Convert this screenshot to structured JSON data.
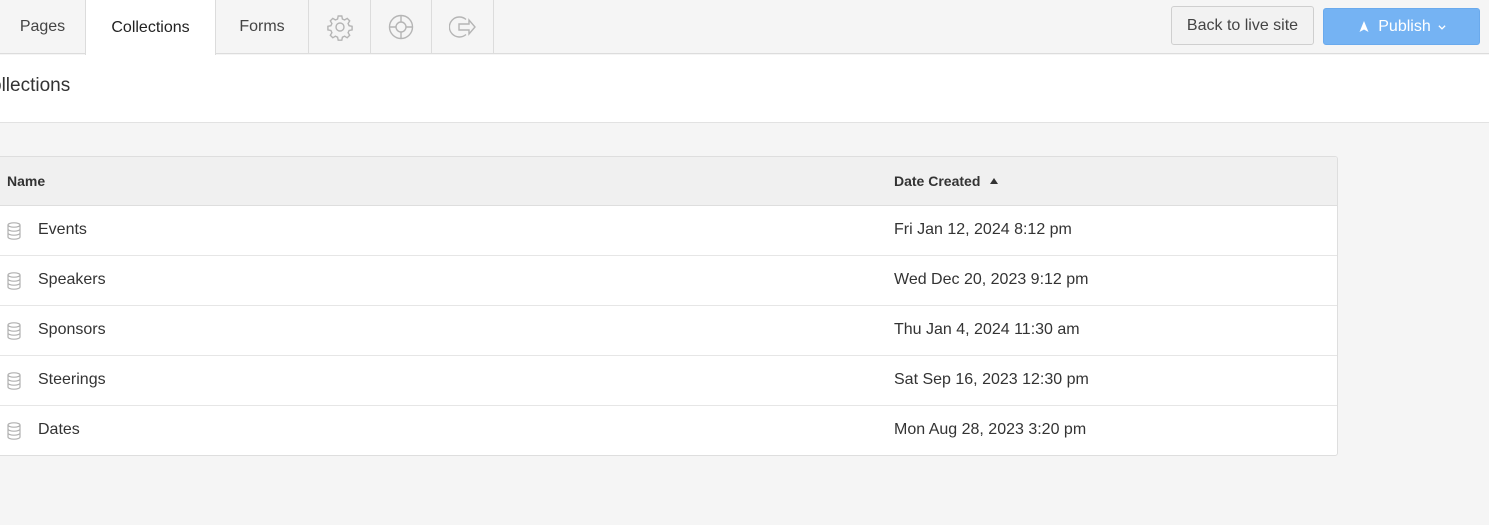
{
  "nav": {
    "tabs": [
      {
        "label": "Pages"
      },
      {
        "label": "Collections"
      },
      {
        "label": "Forms"
      }
    ],
    "icons": [
      "gear-icon",
      "lifebuoy-icon",
      "exit-icon"
    ],
    "back_label": "Back to live site",
    "publish_label": "Publish",
    "publish_color": "#75b3f3"
  },
  "page": {
    "title": "ollections"
  },
  "table": {
    "columns": {
      "name": "Name",
      "date": "Date Created"
    },
    "rows": [
      {
        "name": "Events",
        "date": "Fri Jan 12, 2024 8:12 pm"
      },
      {
        "name": "Speakers",
        "date": "Wed Dec 20, 2023 9:12 pm"
      },
      {
        "name": "Sponsors",
        "date": "Thu Jan 4, 2024 11:30 am"
      },
      {
        "name": "Steerings",
        "date": "Sat Sep 16, 2023 12:30 pm"
      },
      {
        "name": "Dates",
        "date": "Mon Aug 28, 2023 3:20 pm"
      }
    ]
  }
}
